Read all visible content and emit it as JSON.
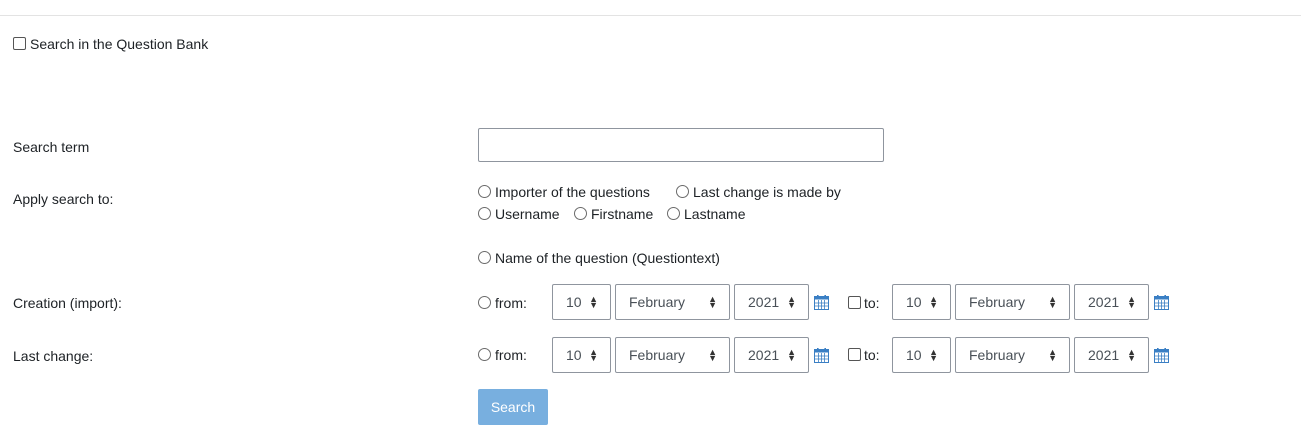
{
  "header": {
    "search_checkbox_label": "Search in the Question Bank"
  },
  "form": {
    "search_term_label": "Search term",
    "search_term_value": "",
    "apply_label": "Apply search to:",
    "apply_options": [
      "Importer of the questions",
      "Last change is made by",
      "Username",
      "Firstname",
      "Lastname",
      "Name of the question (Questiontext)"
    ],
    "creation": {
      "label": "Creation (import):",
      "from_label": "from:",
      "to_label": "to:",
      "from_day": "10",
      "from_month": "February",
      "from_year": "2021",
      "to_day": "10",
      "to_month": "February",
      "to_year": "2021"
    },
    "last_change": {
      "label": "Last change:",
      "from_label": "from:",
      "to_label": "to:",
      "from_day": "10",
      "from_month": "February",
      "from_year": "2021",
      "to_day": "10",
      "to_month": "February",
      "to_year": "2021"
    },
    "search_button": "Search"
  },
  "colors": {
    "button_bg": "#78afdf",
    "calendar_icon": "#3a7fc4"
  },
  "icons": {
    "calendar": "calendar-icon",
    "select_arrows": "sort-arrows-icon"
  }
}
